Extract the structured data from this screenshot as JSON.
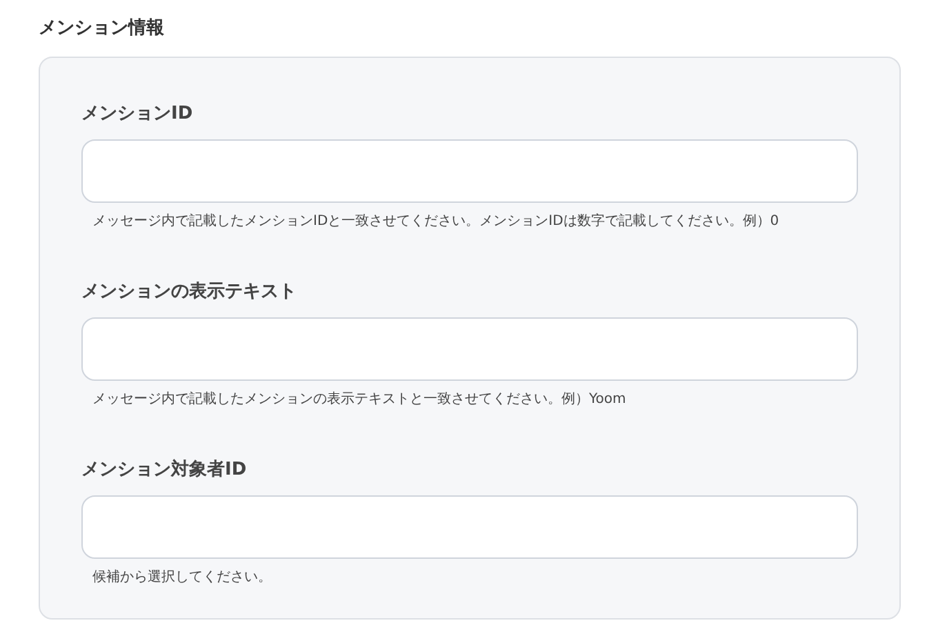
{
  "section_title": "メンション情報",
  "fields": [
    {
      "label": "メンションID",
      "help": "メッセージ内で記載したメンションIDと一致させてください。メンションIDは数字で記載してください。例）0"
    },
    {
      "label": "メンションの表示テキスト",
      "help": "メッセージ内で記載したメンションの表示テキストと一致させてください。例）Yoom"
    },
    {
      "label": "メンション対象者ID",
      "help": "候補から選択してください。"
    }
  ]
}
